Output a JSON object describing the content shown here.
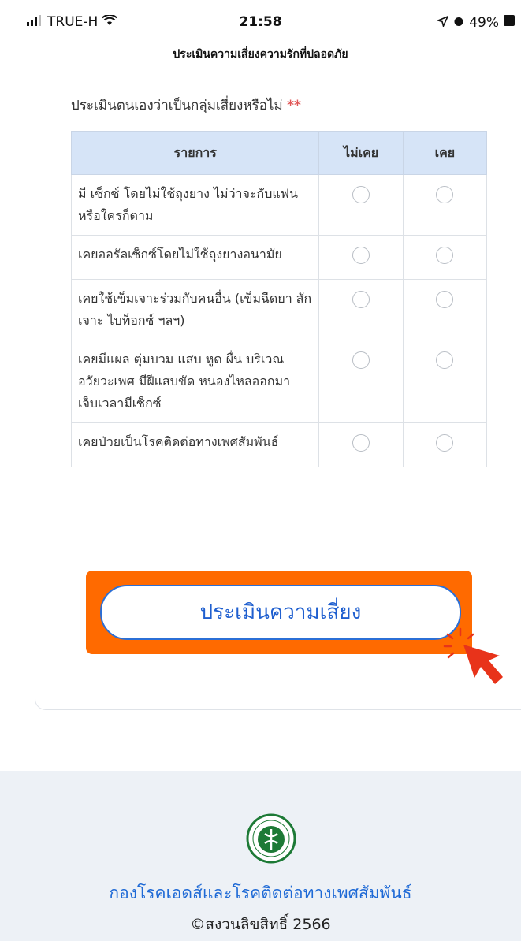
{
  "status_bar": {
    "carrier": "TRUE-H",
    "time": "21:58",
    "battery": "49%"
  },
  "page_title": "ประเมินความเสี่ยงความรักที่ปลอดภัย",
  "form": {
    "question": "ประเมินตนเองว่าเป็นกลุ่มเสี่ยงหรือไม่",
    "required_mark": "**",
    "columns": [
      "รายการ",
      "ไม่เคย",
      "เคย"
    ],
    "rows": [
      {
        "label": "มี เซ็กซ์ โดยไม่ใช้ถุงยาง ไม่ว่าจะกับแฟนหรือใครก็ตาม",
        "never": false,
        "ever": false
      },
      {
        "label": "เคยออรัลเซ็กซ์โดยไม่ใช้ถุงยางอนามัย",
        "never": false,
        "ever": false
      },
      {
        "label": "เคยใช้เข็มเจาะร่วมกับคนอื่น (เข็มฉีดยา สัก เจาะ ไบท็อกซ์ ฯลฯ)",
        "never": false,
        "ever": false
      },
      {
        "label": "เคยมีแผล ตุ่มบวม แสบ หูด ผื่น บริเวณอวัยวะเพศ มีฝีแสบขัด หนองไหลออกมา เจ็บเวลามีเซ็กซ์",
        "never": false,
        "ever": false
      },
      {
        "label": "เคยป่วยเป็นโรคติดต่อทางเพศสัมพันธ์",
        "never": false,
        "ever": false
      }
    ],
    "submit_label": "ประเมินความเสี่ยง"
  },
  "footer": {
    "org_name": "กองโรคเอดส์และโรคติดต่อทางเพศสัมพันธ์",
    "copyright": "©สงวนลิขสิทธิ์ 2566",
    "logo_icon": "ministry-of-public-health-seal-icon"
  },
  "colors": {
    "accent": "#1f5fcf",
    "highlight": "#ff6a00",
    "table_header": "#d6e4f7",
    "required": "#e05555"
  }
}
